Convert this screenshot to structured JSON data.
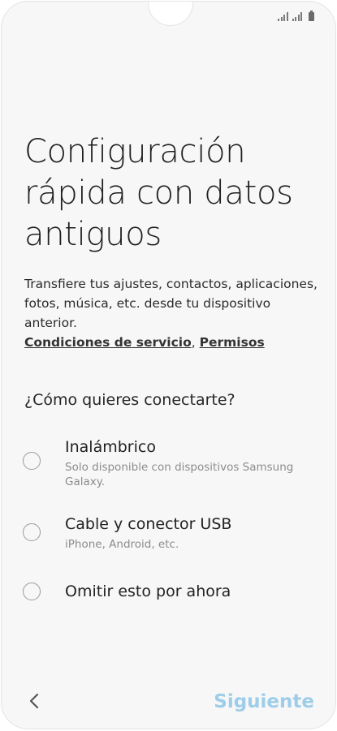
{
  "screen": {
    "title": "Configuración rápida con datos antiguos",
    "description": "Transfiere tus ajustes, contactos, aplicaciones, fotos, música, etc. desde tu dispositivo anterior.",
    "links": {
      "terms": "Condiciones de servicio",
      "separator": ", ",
      "permissions": "Permisos"
    },
    "question": "¿Cómo quieres conectarte?",
    "options": [
      {
        "title": "Inalámbrico",
        "subtitle": "Solo disponible con dispositivos Samsung Galaxy.",
        "selected": false
      },
      {
        "title": "Cable y conector USB",
        "subtitle": "iPhone, Android, etc.",
        "selected": false
      },
      {
        "title": "Omitir esto por ahora",
        "subtitle": "",
        "selected": false
      }
    ]
  },
  "navigation": {
    "back_icon": "chevron-left-icon",
    "next_label": "Siguiente"
  },
  "status_bar": {
    "icons": [
      "signal-icon",
      "signal-icon",
      "battery-icon"
    ]
  },
  "colors": {
    "background": "#f7f7f7",
    "next_button_disabled": "#9ecde9",
    "text_primary": "#222222",
    "text_secondary": "#8c8c8c"
  }
}
